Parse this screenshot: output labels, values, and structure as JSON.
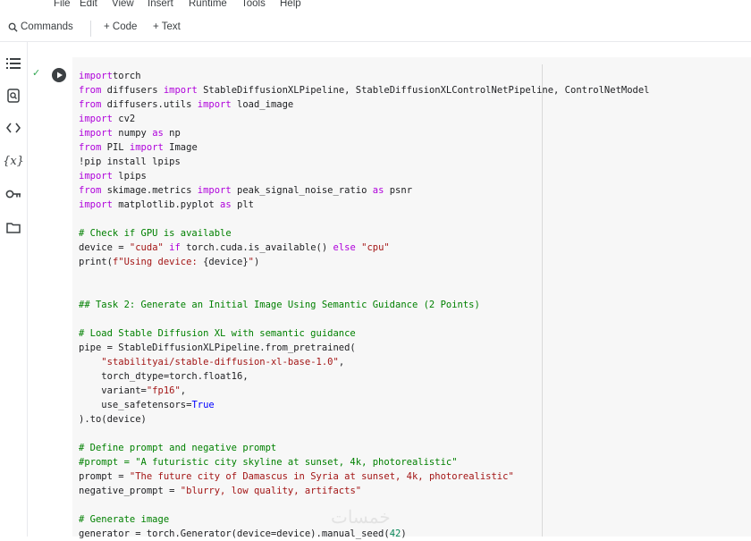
{
  "menu": [
    "File",
    "Edit",
    "View",
    "Insert",
    "Runtime",
    "Tools",
    "Help"
  ],
  "toolbar": {
    "commands_label": "Commands",
    "code_label": "+ Code",
    "text_label": "+ Text"
  },
  "sidebar_icons": [
    "table-of-contents-icon",
    "find-replace-icon",
    "code-snippets-icon",
    "variables-icon",
    "secrets-key-icon",
    "files-folder-icon"
  ],
  "variables_label": "{x}",
  "cell": {
    "status": "✓",
    "code_lines": [
      [
        [
          "kw",
          "import"
        ],
        [
          "",
          "torch"
        ]
      ],
      [
        [
          "kw",
          "from"
        ],
        [
          "",
          " diffusers "
        ],
        [
          "kw",
          "import"
        ],
        [
          "",
          " StableDiffusionXLPipeline, StableDiffusionXLControlNetPipeline, ControlNetModel"
        ]
      ],
      [
        [
          "kw",
          "from"
        ],
        [
          "",
          " diffusers.utils "
        ],
        [
          "kw",
          "import"
        ],
        [
          "",
          " load_image"
        ]
      ],
      [
        [
          "kw",
          "import"
        ],
        [
          "",
          " cv2"
        ]
      ],
      [
        [
          "kw",
          "import"
        ],
        [
          "",
          " numpy "
        ],
        [
          "kw",
          "as"
        ],
        [
          "",
          " np"
        ]
      ],
      [
        [
          "kw",
          "from"
        ],
        [
          "",
          " PIL "
        ],
        [
          "kw",
          "import"
        ],
        [
          "",
          " Image"
        ]
      ],
      [
        [
          "",
          "!pip install lpips"
        ]
      ],
      [
        [
          "kw",
          "import"
        ],
        [
          "",
          " lpips"
        ]
      ],
      [
        [
          "kw",
          "from"
        ],
        [
          "",
          " skimage.metrics "
        ],
        [
          "kw",
          "import"
        ],
        [
          "",
          " peak_signal_noise_ratio "
        ],
        [
          "kw",
          "as"
        ],
        [
          "",
          " psnr"
        ]
      ],
      [
        [
          "kw",
          "import"
        ],
        [
          "",
          " matplotlib.pyplot "
        ],
        [
          "kw",
          "as"
        ],
        [
          "",
          " plt"
        ]
      ],
      [],
      [
        [
          "cm",
          "# Check if GPU is available"
        ]
      ],
      [
        [
          "",
          "device = "
        ],
        [
          "str",
          "\"cuda\""
        ],
        [
          "kw",
          " if"
        ],
        [
          "",
          " torch.cuda.is_available() "
        ],
        [
          "kw",
          "else"
        ],
        [
          "str",
          " \"cpu\""
        ]
      ],
      [
        [
          "",
          "print("
        ],
        [
          "str",
          "f\"Using device: "
        ],
        [
          "",
          "{device}"
        ],
        [
          "str",
          "\""
        ],
        [
          "",
          ")"
        ]
      ],
      [],
      [],
      [
        [
          "cm",
          "## Task 2: Generate an Initial Image Using Semantic Guidance (2 Points)"
        ]
      ],
      [],
      [
        [
          "cm",
          "# Load Stable Diffusion XL with semantic guidance"
        ]
      ],
      [
        [
          "",
          "pipe = StableDiffusionXLPipeline.from_pretrained("
        ]
      ],
      [
        [
          "",
          "    "
        ],
        [
          "str",
          "\"stabilityai/stable-diffusion-xl-base-1.0\""
        ],
        [
          "",
          ","
        ]
      ],
      [
        [
          "",
          "    torch_dtype=torch.float16,"
        ]
      ],
      [
        [
          "",
          "    variant="
        ],
        [
          "str",
          "\"fp16\""
        ],
        [
          "",
          ","
        ]
      ],
      [
        [
          "",
          "    use_safetensors="
        ],
        [
          "bl",
          "True"
        ]
      ],
      [
        [
          "",
          ").to(device)"
        ]
      ],
      [],
      [
        [
          "cm",
          "# Define prompt and negative prompt"
        ]
      ],
      [
        [
          "cm",
          "#prompt = \"A futuristic city skyline at sunset, 4k, photorealistic\""
        ]
      ],
      [
        [
          "",
          "prompt = "
        ],
        [
          "str",
          "\"The future city of Damascus in Syria at sunset, 4k, photorealistic\""
        ]
      ],
      [
        [
          "",
          "negative_prompt = "
        ],
        [
          "str",
          "\"blurry, low quality, artifacts\""
        ]
      ],
      [],
      [
        [
          "cm",
          "# Generate image"
        ]
      ],
      [
        [
          "",
          "generator = torch.Generator(device=device).manual_seed("
        ],
        [
          "num",
          "42"
        ],
        [
          "",
          ")"
        ]
      ]
    ]
  },
  "watermark": "خمسات"
}
